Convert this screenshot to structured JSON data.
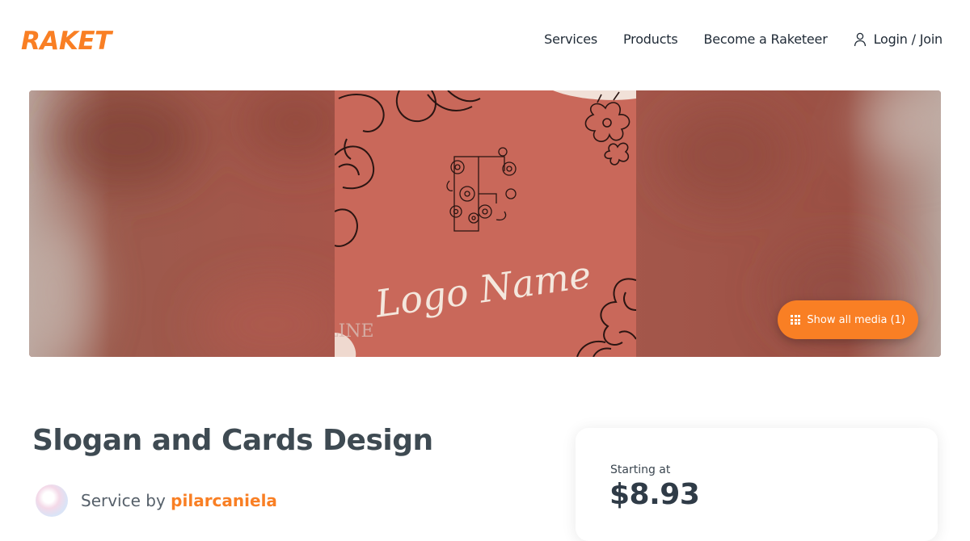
{
  "header": {
    "logo_text": "RAKET",
    "nav": {
      "services": "Services",
      "products": "Products",
      "become": "Become a Raketeer",
      "login": "Login / Join"
    }
  },
  "hero": {
    "image_text": "Logo Name",
    "watermark": "LINE",
    "show_media_label": "Show all media (1)"
  },
  "service": {
    "title": "Slogan and Cards Design",
    "by_prefix": "Service by",
    "seller": "pilarcaniela"
  },
  "pricing": {
    "label": "Starting at",
    "price": "$8.93"
  },
  "colors": {
    "brand": "#f97f24",
    "text": "#3e4a52",
    "card_bg": "#c9685a"
  },
  "icons": [
    "user-icon",
    "grid-icon",
    "floral-monogram-icon"
  ]
}
